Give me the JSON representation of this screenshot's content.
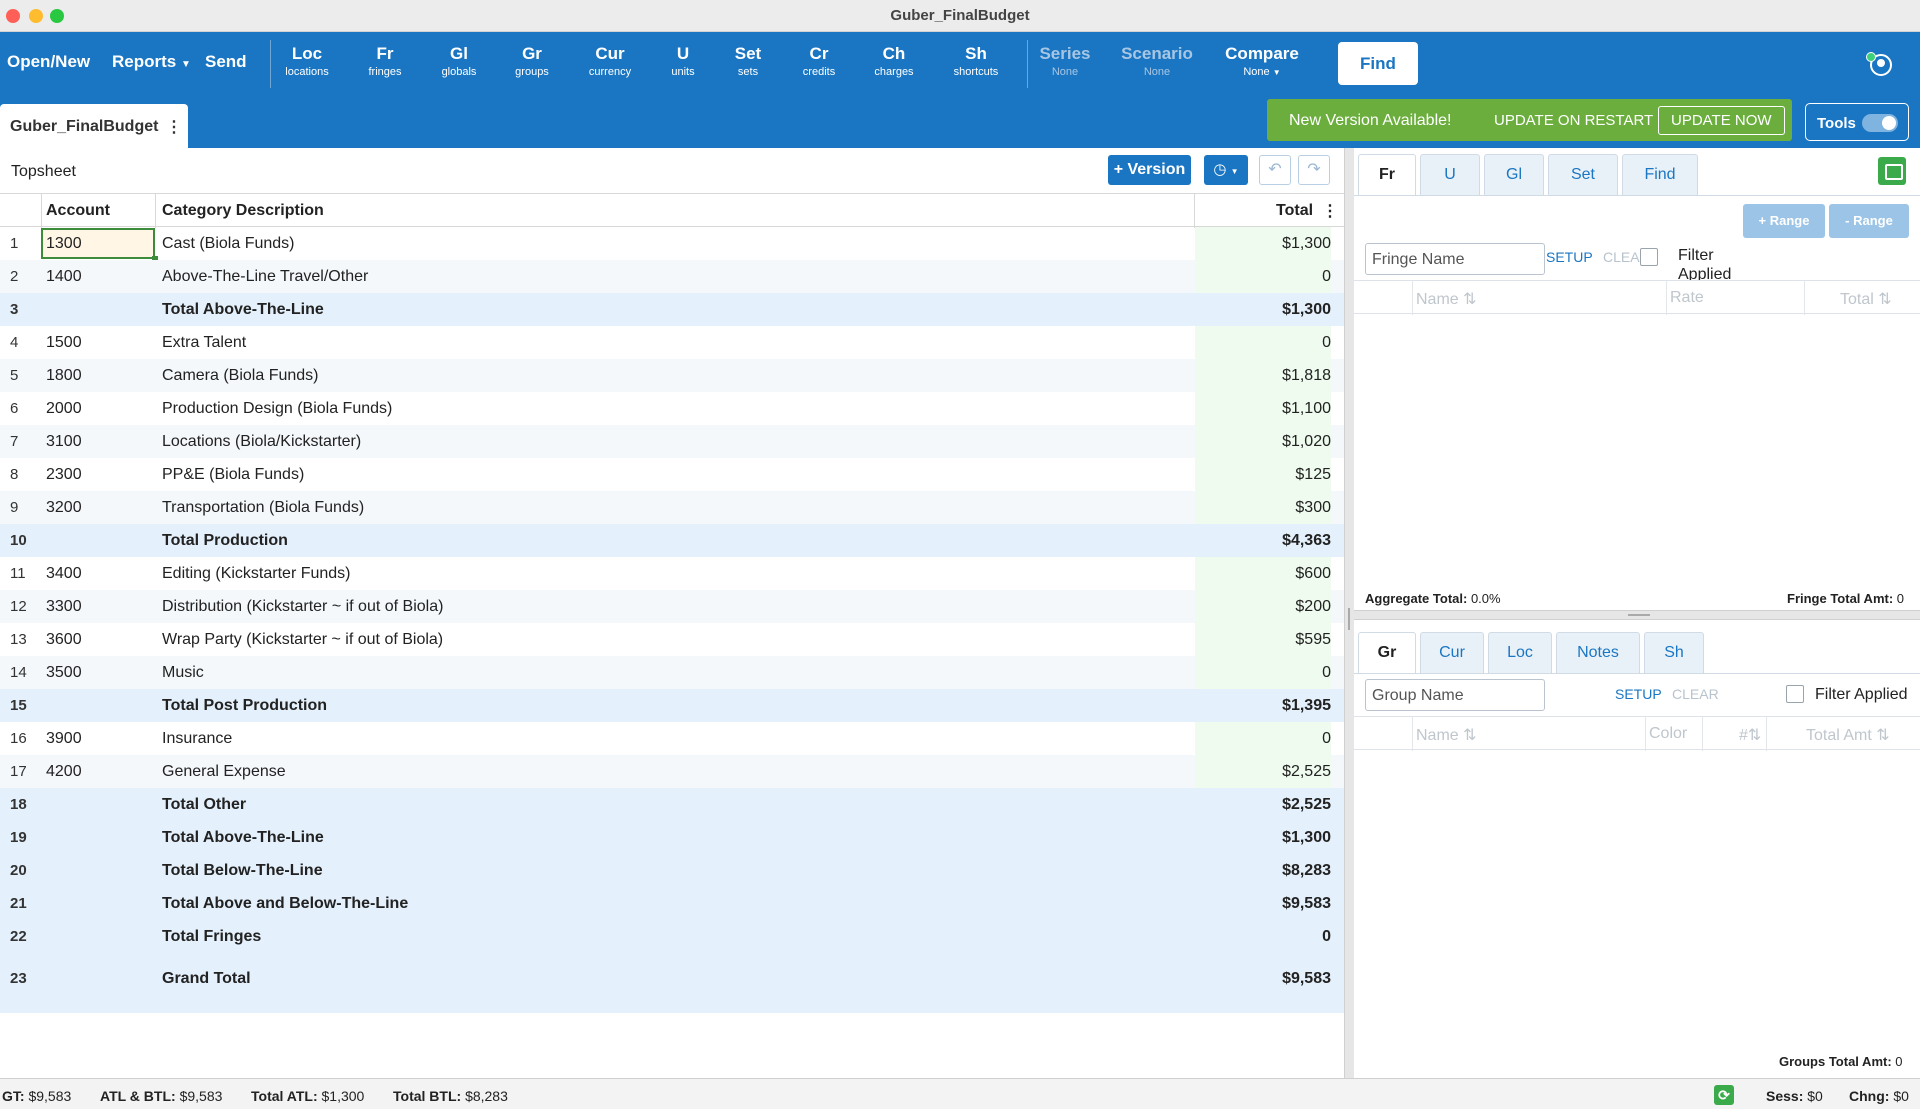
{
  "window": {
    "title": "Guber_FinalBudget"
  },
  "toolbar": {
    "open_new": "Open/New",
    "reports": "Reports",
    "send": "Send",
    "items": [
      {
        "abbr": "Loc",
        "sub": "locations"
      },
      {
        "abbr": "Fr",
        "sub": "fringes"
      },
      {
        "abbr": "Gl",
        "sub": "globals"
      },
      {
        "abbr": "Gr",
        "sub": "groups"
      },
      {
        "abbr": "Cur",
        "sub": "currency"
      },
      {
        "abbr": "U",
        "sub": "units"
      },
      {
        "abbr": "Set",
        "sub": "sets"
      },
      {
        "abbr": "Cr",
        "sub": "credits"
      },
      {
        "abbr": "Ch",
        "sub": "charges"
      },
      {
        "abbr": "Sh",
        "sub": "shortcuts"
      }
    ],
    "series": {
      "label": "Series",
      "value": "None"
    },
    "scenario": {
      "label": "Scenario",
      "value": "None"
    },
    "compare": {
      "label": "Compare",
      "value": "None"
    },
    "find": "Find",
    "accent": "#1a76c2"
  },
  "tabbar": {
    "doc_tab": "Guber_FinalBudget",
    "update_msg": "New Version Available!",
    "update_on_restart": "UPDATE ON RESTART",
    "update_now": "UPDATE NOW",
    "tools": "Tools",
    "tools_on": true
  },
  "topsheet": {
    "label": "Topsheet",
    "version_btn": "+ Version",
    "columns": {
      "account": "Account",
      "description": "Category Description",
      "total": "Total"
    },
    "rows": [
      {
        "n": "1",
        "account": "1300",
        "desc": "Cast (Biola Funds)",
        "total": "$1,300",
        "type": "data",
        "selected": true
      },
      {
        "n": "2",
        "account": "1400",
        "desc": "Above-The-Line Travel/Other",
        "total": "0",
        "type": "data"
      },
      {
        "n": "3",
        "account": "",
        "desc": "Total Above-The-Line",
        "total": "$1,300",
        "type": "total"
      },
      {
        "n": "4",
        "account": "1500",
        "desc": "Extra Talent",
        "total": "0",
        "type": "data"
      },
      {
        "n": "5",
        "account": "1800",
        "desc": "Camera (Biola Funds)",
        "total": "$1,818",
        "type": "data"
      },
      {
        "n": "6",
        "account": "2000",
        "desc": "Production Design (Biola Funds)",
        "total": "$1,100",
        "type": "data"
      },
      {
        "n": "7",
        "account": "3100",
        "desc": "Locations (Biola/Kickstarter)",
        "total": "$1,020",
        "type": "data"
      },
      {
        "n": "8",
        "account": "2300",
        "desc": "PP&E (Biola Funds)",
        "total": "$125",
        "type": "data"
      },
      {
        "n": "9",
        "account": "3200",
        "desc": "Transportation (Biola Funds)",
        "total": "$300",
        "type": "data"
      },
      {
        "n": "10",
        "account": "",
        "desc": "Total Production",
        "total": "$4,363",
        "type": "total"
      },
      {
        "n": "11",
        "account": "3400",
        "desc": "Editing (Kickstarter Funds)",
        "total": "$600",
        "type": "data"
      },
      {
        "n": "12",
        "account": "3300",
        "desc": "Distribution (Kickstarter ~ if out of Biola)",
        "total": "$200",
        "type": "data"
      },
      {
        "n": "13",
        "account": "3600",
        "desc": "Wrap Party (Kickstarter ~ if out of Biola)",
        "total": "$595",
        "type": "data"
      },
      {
        "n": "14",
        "account": "3500",
        "desc": "Music",
        "total": "0",
        "type": "data"
      },
      {
        "n": "15",
        "account": "",
        "desc": "Total Post Production",
        "total": "$1,395",
        "type": "total"
      },
      {
        "n": "16",
        "account": "3900",
        "desc": "Insurance",
        "total": "0",
        "type": "data"
      },
      {
        "n": "17",
        "account": "4200",
        "desc": "General Expense",
        "total": "$2,525",
        "type": "data"
      },
      {
        "n": "18",
        "account": "",
        "desc": "Total Other",
        "total": "$2,525",
        "type": "total"
      },
      {
        "n": "19",
        "account": "",
        "desc": "Total Above-The-Line",
        "total": "$1,300",
        "type": "total"
      },
      {
        "n": "20",
        "account": "",
        "desc": "Total Below-The-Line",
        "total": "$8,283",
        "type": "total"
      },
      {
        "n": "21",
        "account": "",
        "desc": "Total Above and Below-The-Line",
        "total": "$9,583",
        "type": "total"
      },
      {
        "n": "22",
        "account": "",
        "desc": "Total Fringes",
        "total": "0",
        "type": "total"
      },
      {
        "n": "23",
        "account": "",
        "desc": "Grand Total",
        "total": "$9,583",
        "type": "grand"
      }
    ]
  },
  "fringes_panel": {
    "tabs": [
      "Fr",
      "U",
      "Gl",
      "Set",
      "Find"
    ],
    "add_range": "+ Range",
    "remove_range": "- Range",
    "name_placeholder": "Fringe Name",
    "setup": "SETUP",
    "clear": "CLEAR",
    "filter_applied": "Filter Applied",
    "columns": [
      "Name",
      "Rate",
      "Total"
    ],
    "aggregate_label": "Aggregate Total:",
    "aggregate_value": "0.0%",
    "fringe_total_label": "Fringe Total Amt:",
    "fringe_total_value": "0"
  },
  "groups_panel": {
    "tabs": [
      "Gr",
      "Cur",
      "Loc",
      "Notes",
      "Sh"
    ],
    "name_placeholder": "Group Name",
    "setup": "SETUP",
    "clear": "CLEAR",
    "filter_applied": "Filter Applied",
    "columns": [
      "Name",
      "Color",
      "#",
      "Total Amt"
    ],
    "groups_total_label": "Groups Total Amt:",
    "groups_total_value": "0"
  },
  "statusbar": {
    "gt_label": "GT:",
    "gt_value": "$9,583",
    "atl_btl_label": "ATL & BTL:",
    "atl_btl_value": "$9,583",
    "total_atl_label": "Total ATL:",
    "total_atl_value": "$1,300",
    "total_btl_label": "Total BTL:",
    "total_btl_value": "$8,283",
    "sess_label": "Sess:",
    "sess_value": "$0",
    "chng_label": "Chng:",
    "chng_value": "$0"
  }
}
